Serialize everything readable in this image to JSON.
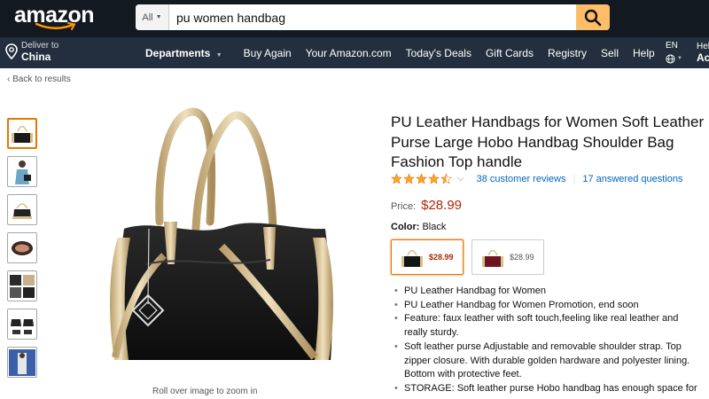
{
  "header": {
    "logo_text": "amazon",
    "search": {
      "category": "All",
      "query": "pu women handbag"
    }
  },
  "nav": {
    "deliver_line1": "Deliver to",
    "deliver_line2": "China",
    "departments_label": "Departments",
    "items": [
      "Buy Again",
      "Your Amazon.com",
      "Today's Deals",
      "Gift Cards",
      "Registry",
      "Sell",
      "Help"
    ],
    "language": "EN",
    "hello_line1": "Hel",
    "hello_line2": "Ac"
  },
  "breadcrumb": {
    "back_label": "Back to results"
  },
  "gallery": {
    "thumbnail_count": 7,
    "active_index": 0,
    "zoom_hint": "Roll over image to zoom in"
  },
  "product": {
    "title": "PU Leather Handbags for Women Soft Leather Purse Large Hobo Handbag Shoulder Bag Fashion Top handle",
    "rating": 4.5,
    "reviews_label": "38 customer reviews",
    "questions_label": "17 answered questions",
    "price_label": "Price:",
    "price": "$28.99",
    "color_label": "Color:",
    "color_value": "Black",
    "variants": [
      {
        "color": "black",
        "price": "$28.99",
        "selected": true
      },
      {
        "color": "burgundy",
        "price": "$28.99",
        "selected": false
      }
    ],
    "bullets": [
      "PU Leather Handbag for Women",
      "PU Leather Handbag for Women Promotion, end soon",
      "Feature: faux leather with soft touch,feeling like real leather and really sturdy.",
      "Soft leather purse Adjustable and removable shoulder strap. Top zipper closure. With durable golden hardware and polyester lining. Bottom with protective feet.",
      "STORAGE: Soft leather purse Hobo handbag has enough space for"
    ]
  },
  "colors": {
    "topbar": "#131921",
    "navbar": "#232f3e",
    "search_button": "#febd69",
    "price": "#b12704",
    "link": "#0066c0",
    "star": "#ffa41c",
    "selected_border": "#e77600"
  }
}
